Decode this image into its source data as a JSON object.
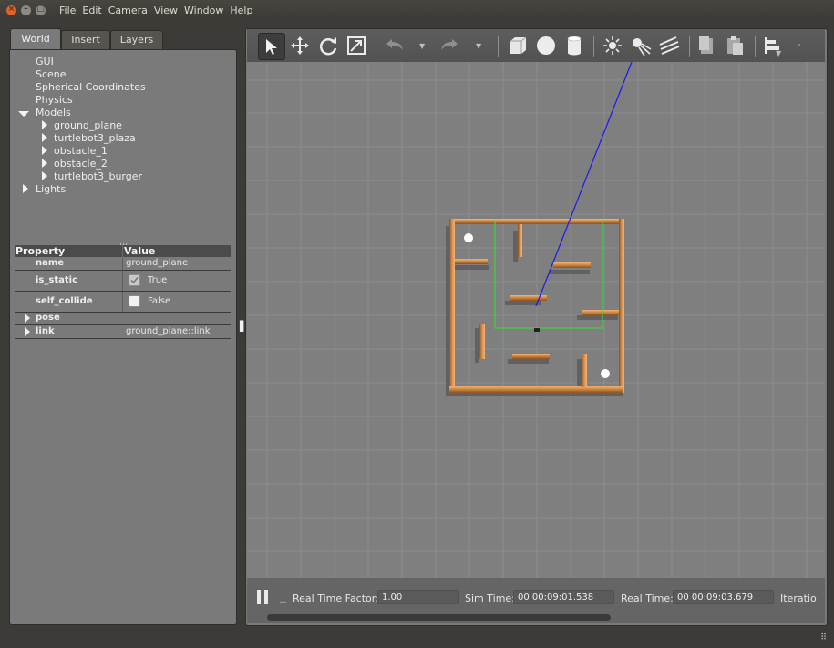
{
  "menubar": {
    "window_buttons": {
      "close_glyph": "×",
      "min_glyph": "–",
      "max_glyph": "□"
    },
    "menus": [
      "File",
      "Edit",
      "Camera",
      "View",
      "Window",
      "Help"
    ]
  },
  "left_panel": {
    "tabs": [
      "World",
      "Insert",
      "Layers"
    ],
    "active_tab": "World",
    "tree": {
      "gui": "GUI",
      "scene": "Scene",
      "spherical": "Spherical Coordinates",
      "physics": "Physics",
      "models": "Models",
      "model_items": [
        "ground_plane",
        "turtlebot3_plaza",
        "obstacle_1",
        "obstacle_2",
        "turtlebot3_burger"
      ],
      "lights": "Lights"
    },
    "properties": {
      "header_property": "Property",
      "header_value": "Value",
      "rows": {
        "name": {
          "key": "name",
          "value": "ground_plane"
        },
        "is_static": {
          "key": "is_static",
          "value": "True",
          "checked": true
        },
        "self_collide": {
          "key": "self_collide",
          "value": "False",
          "checked": false
        },
        "pose": {
          "key": "pose",
          "value": ""
        },
        "link": {
          "key": "link",
          "value": "ground_plane::link"
        }
      }
    }
  },
  "toolbar": {
    "icons": [
      "select-arrow-icon",
      "translate-icon",
      "rotate-icon",
      "scale-icon",
      "undo-icon",
      "redo-icon",
      "box-icon",
      "sphere-icon",
      "cylinder-icon",
      "point-light-icon",
      "spot-light-icon",
      "directional-light-icon",
      "copy-icon",
      "paste-icon",
      "align-icon"
    ],
    "active_tool": "select-arrow-icon"
  },
  "statusbar": {
    "rtf_label": "Real Time Factor:",
    "rtf_value": "1.00",
    "sim_label": "Sim Time:",
    "sim_value": "00 00:09:01.538",
    "real_label": "Real Time:",
    "real_value": "00 00:09:03.679",
    "iter_label": "Iteratio"
  },
  "colors": {
    "scene_bg": "#7f7f7f",
    "wall": "#c8843e",
    "selection_box": "#3cd63c",
    "laser": "#1a1aee"
  }
}
